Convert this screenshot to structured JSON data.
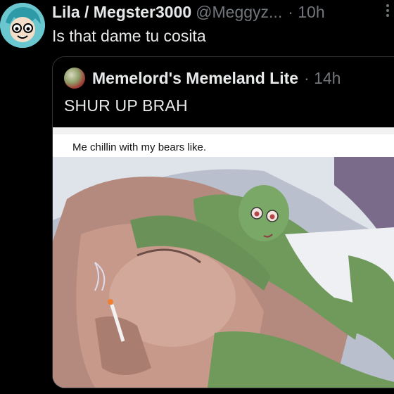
{
  "tweet": {
    "display_name": "Lila / Megster3000",
    "handle": "@Meggyz...",
    "time": "· 10h",
    "text": "Is that dame tu cosita"
  },
  "quote": {
    "display_name": "Memelord's Memeland Lite",
    "time": "· 14h",
    "text": "SHUR UP BRAH",
    "media": {
      "caption": "Me chillin with my  bears like."
    }
  },
  "icons": [
    "avatar",
    "more-icon",
    "quote-avatar"
  ]
}
